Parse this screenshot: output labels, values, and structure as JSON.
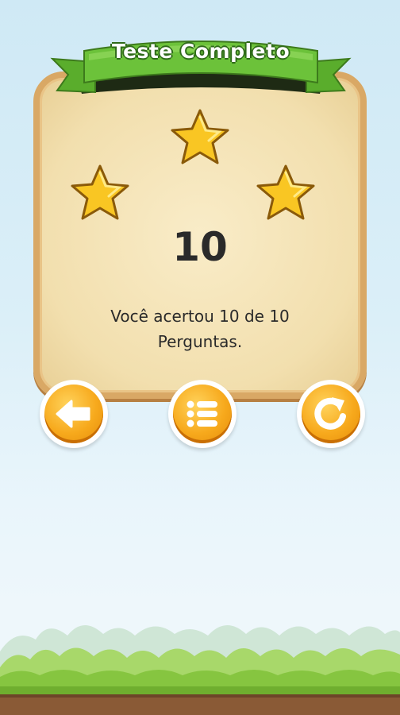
{
  "dialog": {
    "title": "Teste Completo",
    "stars_earned": 3,
    "stars_total": 3,
    "score": "10",
    "message_line1": "Você acertou 10 de 10",
    "message_line2": "Perguntas."
  },
  "buttons": [
    {
      "name": "back",
      "icon": "arrow-left-icon"
    },
    {
      "name": "list",
      "icon": "list-icon"
    },
    {
      "name": "restart",
      "icon": "restart-icon"
    }
  ],
  "colors": {
    "ribbon_green": "#6cc23a",
    "star_gold": "#f9c623",
    "button_orange": "#f7a91c",
    "panel_parchment": "#f2dfae"
  }
}
